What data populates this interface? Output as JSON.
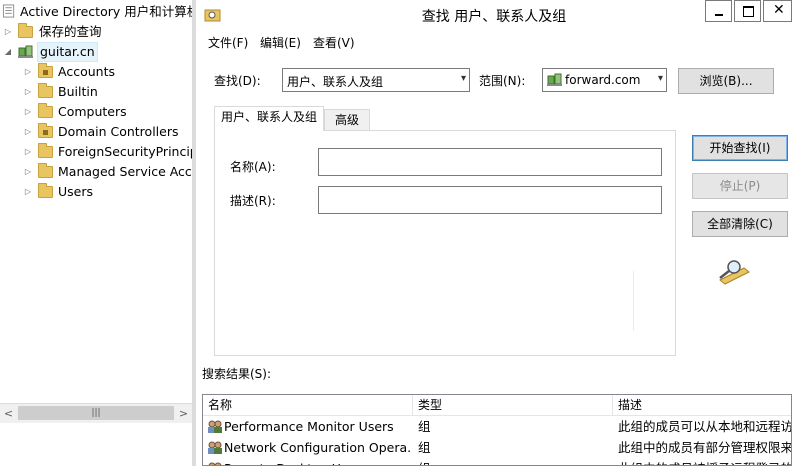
{
  "tree": {
    "root_label": "Active Directory 用户和计算机",
    "saved_queries": "保存的查询",
    "domain": "guitar.cn",
    "children": [
      "Accounts",
      "Builtin",
      "Computers",
      "Domain Controllers",
      "ForeignSecurityPrincipals",
      "Managed Service Accounts",
      "Users"
    ]
  },
  "dialog": {
    "title": "查找 用户、联系人及组",
    "menu": {
      "file": "文件(F)",
      "file_key": "F",
      "edit": "编辑(E)",
      "edit_key": "E",
      "view": "查看(V)",
      "view_key": "V"
    },
    "find_label": "查找(D):",
    "find_value": "用户、联系人及组",
    "scope_label": "范围(N):",
    "scope_value": "forward.com",
    "browse_button": "浏览(B)...",
    "tabs": [
      "用户、联系人及组",
      "高级"
    ],
    "name_label": "名称(A):",
    "desc_label": "描述(R):",
    "name_value": "",
    "desc_value": "",
    "start_button": "开始查找(I)",
    "stop_button": "停止(P)",
    "clear_button": "全部清除(C)",
    "results_label": "搜索结果(S):",
    "columns": [
      "名称",
      "类型",
      "描述"
    ],
    "rows": [
      {
        "name": "Performance Monitor Users",
        "type": "组",
        "desc": "此组的成员可以从本地和远程访问"
      },
      {
        "name": "Network Configuration Opera...",
        "type": "组",
        "desc": "此组中的成员有部分管理权限来"
      },
      {
        "name": "Remote Desktop Users",
        "type": "组",
        "desc": "此组中的成员被授予远程登录的权"
      }
    ]
  },
  "colors": {
    "folder": "#e9c562",
    "selection": "#e5f3fb",
    "primary_button_border": "#3c7fb1"
  }
}
